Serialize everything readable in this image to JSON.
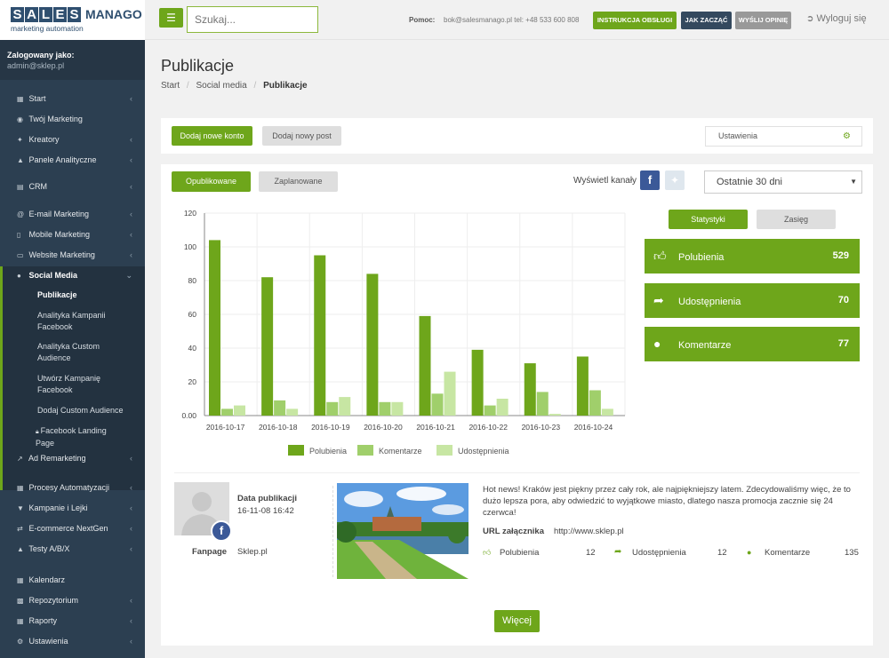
{
  "logo": {
    "letters": [
      "S",
      "A",
      "L",
      "E",
      "S"
    ],
    "manago": "MANAGO",
    "sub": "marketing automation"
  },
  "topbar": {
    "menu_icon": "hamburger-icon",
    "search_placeholder": "Szukaj...",
    "help_label": "Pomoc:",
    "help_contact": "bok@salesmanago.pl tel: +48 533 600 808",
    "buttons": [
      {
        "label": "INSTRUKCJA OBSŁUGI",
        "color": "#6ea61b"
      },
      {
        "label": "JAK ZACZĄĆ",
        "color": "#34495e"
      },
      {
        "label": "WYŚLIJ OPINIĘ",
        "color": "#999999"
      }
    ],
    "logout": "Wyloguj się"
  },
  "sidebar": {
    "user_label": "Zalogowany jako:",
    "user_email": "admin@sklep.pl",
    "items": [
      {
        "label": "Start",
        "icon": "grid-icon",
        "arrow": true
      },
      {
        "label": "Twój Marketing",
        "icon": "eye-icon",
        "arrow": false
      },
      {
        "label": "Kreatory",
        "icon": "wand-icon",
        "arrow": true
      },
      {
        "label": "Panele Analityczne",
        "icon": "chart-icon",
        "arrow": true
      },
      {
        "label": "CRM",
        "icon": "bar-chart-icon",
        "arrow": true
      },
      {
        "label": "E-mail Marketing",
        "icon": "at-icon",
        "arrow": true
      },
      {
        "label": "Mobile Marketing",
        "icon": "mobile-icon",
        "arrow": true
      },
      {
        "label": "Website Marketing",
        "icon": "laptop-icon",
        "arrow": true
      },
      {
        "label": "Social Media",
        "icon": "users-icon",
        "arrow": true
      },
      {
        "label": "Ad Remarketing",
        "icon": "trend-icon",
        "arrow": true
      },
      {
        "label": "Procesy Automatyzacji",
        "icon": "grid-icon",
        "arrow": true
      },
      {
        "label": "Kampanie i Lejki",
        "icon": "filter-icon",
        "arrow": true
      },
      {
        "label": "E-commerce NextGen",
        "icon": "exchange-icon",
        "arrow": true
      },
      {
        "label": "Testy A/B/X",
        "icon": "flask-icon",
        "arrow": true
      },
      {
        "label": "Kalendarz",
        "icon": "calendar-icon",
        "arrow": false
      },
      {
        "label": "Repozytorium",
        "icon": "cart-icon",
        "arrow": true
      },
      {
        "label": "Raporty",
        "icon": "grid-icon",
        "arrow": true
      },
      {
        "label": "Ustawienia",
        "icon": "gears-icon",
        "arrow": true
      }
    ],
    "sub_items": [
      "Publikacje",
      "Analityka Kampanii Facebook",
      "Analityka Custom Audience",
      "Utwórz Kampanię Facebook",
      "Dodaj Custom Audience",
      "Facebook Landing Page"
    ]
  },
  "page": {
    "title": "Publikacje",
    "breadcrumb": [
      "Start",
      "Social media",
      "Publikacje"
    ]
  },
  "actions": {
    "add_account": "Dodaj nowe konto",
    "add_post": "Dodaj nowy post",
    "settings": "Ustawienia"
  },
  "filters": {
    "published": "Opublikowane",
    "scheduled": "Zaplanowane",
    "channels_label": "Wyświetl kanały",
    "period": "Ostatnie 30 dni"
  },
  "stats": {
    "tab_stats": "Statystyki",
    "tab_reach": "Zasięg",
    "items": [
      {
        "label": "Polubienia",
        "value": "529",
        "icon": "thumbs-up-icon"
      },
      {
        "label": "Udostępnienia",
        "value": "70",
        "icon": "share-icon"
      },
      {
        "label": "Komentarze",
        "value": "77",
        "icon": "comment-icon"
      }
    ]
  },
  "chart_data": {
    "type": "bar",
    "categories": [
      "2016-10-17",
      "2016-10-18",
      "2016-10-19",
      "2016-10-20",
      "2016-10-21",
      "2016-10-22",
      "2016-10-23",
      "2016-10-24"
    ],
    "series": [
      {
        "name": "Polubienia",
        "color": "#6ea61b",
        "values": [
          104,
          82,
          95,
          84,
          59,
          39,
          31,
          35
        ]
      },
      {
        "name": "Komentarze",
        "color": "#a0cf6b",
        "values": [
          4,
          9,
          8,
          8,
          13,
          6,
          14,
          15
        ]
      },
      {
        "name": "Udostępnienia",
        "color": "#c7e6a3",
        "values": [
          6,
          4,
          11,
          8,
          26,
          10,
          1,
          4
        ]
      }
    ],
    "yticks": [
      "0.00",
      "20",
      "40",
      "60",
      "80",
      "100",
      "120"
    ],
    "ylim": [
      0,
      120
    ],
    "grid": true,
    "legend": "bottom"
  },
  "post": {
    "date_label": "Data publikacji",
    "date_value": "16-11-08 16:42",
    "fanpage_label": "Fanpage",
    "fanpage_value": "Sklep.pl",
    "text": "Hot news! Kraków jest piękny przez cały rok, ale najpiękniejszy latem. Zdecydowaliśmy więc, że to dużo lepsza pora, aby odwiedzić to wyjątkowe miasto, dlatego nasza promocja zacznie się 24 czerwca!",
    "url_label": "URL załącznika",
    "url_value": "http://www.sklep.pl",
    "likes_label": "Polubienia",
    "likes_value": "12",
    "shares_label": "Udostępnienia",
    "shares_value": "12",
    "comments_label": "Komentarze",
    "comments_value": "135"
  },
  "more": "Więcej"
}
